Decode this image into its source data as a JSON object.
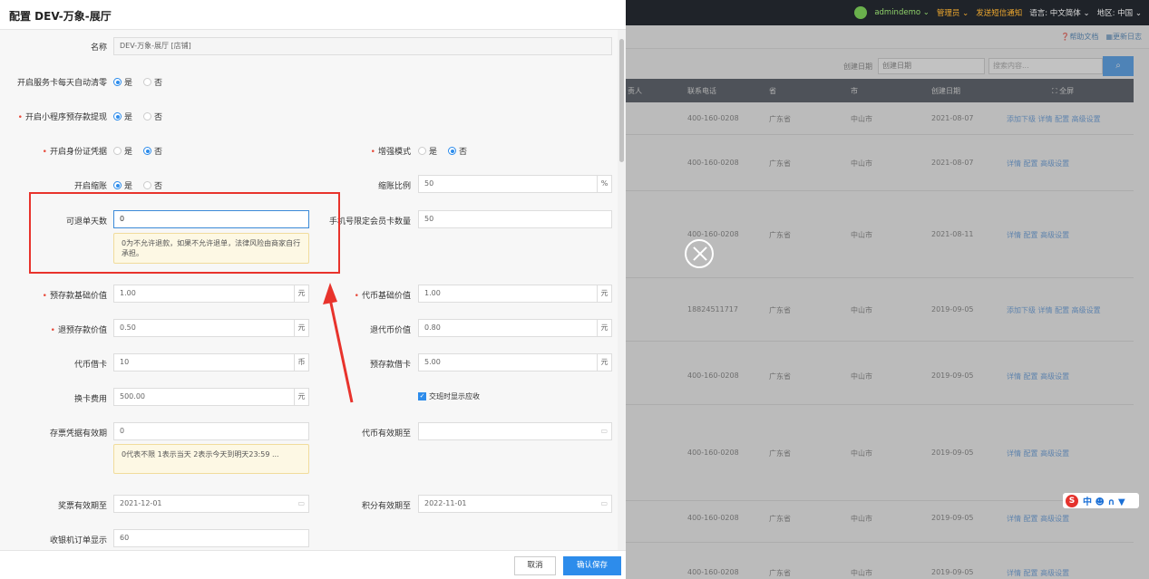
{
  "topbar": {
    "username": "admindemo ⌄",
    "role": "管理员 ⌄",
    "sms": "发送短信通知",
    "language": "语言: 中文简体 ⌄",
    "region": "地区: 中国 ⌄"
  },
  "subbar": {
    "help": "帮助文档",
    "changelog": "更新日志"
  },
  "filter": {
    "date_label": "创建日期",
    "date_placeholder": "创建日期",
    "search_placeholder": "搜索内容..."
  },
  "table": {
    "headers": [
      "责人",
      "联系电话",
      "省",
      "市",
      "创建日期",
      "⛶ 全屏"
    ],
    "rows": [
      {
        "phone": "400-160-0208",
        "province": "广东省",
        "city": "中山市",
        "date": "2021-08-07",
        "ops": "添加下级 详情 配置 高级设置"
      },
      {
        "phone": "400-160-0208",
        "province": "广东省",
        "city": "中山市",
        "date": "2021-08-07",
        "ops": "详情 配置 高级设置"
      },
      {
        "phone": "400-160-0208",
        "province": "广东省",
        "city": "中山市",
        "date": "2021-08-11",
        "ops": "详情 配置 高级设置"
      },
      {
        "phone": "18824511717",
        "province": "广东省",
        "city": "中山市",
        "date": "2019-09-05",
        "ops": "添加下级 详情 配置 高级设置"
      },
      {
        "phone": "400-160-0208",
        "province": "广东省",
        "city": "中山市",
        "date": "2019-09-05",
        "ops": "详情 配置 高级设置"
      },
      {
        "phone": "400-160-0208",
        "province": "广东省",
        "city": "中山市",
        "date": "2019-09-05",
        "ops": "详情 配置 高级设置"
      },
      {
        "phone": "400-160-0208",
        "province": "广东省",
        "city": "中山市",
        "date": "2019-09-05",
        "ops": "详情 配置 高级设置"
      },
      {
        "phone": "400-160-0208",
        "province": "广东省",
        "city": "中山市",
        "date": "2019-09-05",
        "ops": "详情 配置 高级设置"
      }
    ]
  },
  "ime": {
    "logo": "S",
    "items": "中 ☻ ∩ ▼"
  },
  "dialog": {
    "title": "配置 DEV-万象-展厅",
    "name_label": "名称",
    "name_value": "DEV-万象-展厅 [店铺]",
    "auto_clear_label": "开启服务卡每天自动清零",
    "mini_withdraw_label": "开启小程序预存款提现",
    "id_cert_label": "开启身份证凭据",
    "enhanced_label": "增强模式",
    "shrink_label": "开启缩账",
    "shrink_ratio_label": "缩账比例",
    "shrink_ratio_value": "50",
    "shrink_ratio_unit": "%",
    "refund_days_label": "可退单天数",
    "refund_days_value": "0",
    "refund_tip": "0为不允许退款，如果不允许退单，法律风险由商家自行承担。",
    "member_card_label": "手机号限定会员卡数量",
    "member_card_value": "50",
    "deposit_base_label": "预存款基础价值",
    "deposit_base_value": "1.00",
    "coin_base_label": "代币基础价值",
    "coin_base_value": "1.00",
    "refund_deposit_label": "退预存款价值",
    "refund_deposit_value": "0.50",
    "refund_coin_label": "退代币价值",
    "refund_coin_value": "0.80",
    "coin_loan_label": "代币借卡",
    "coin_loan_value": "10",
    "coin_unit": "币",
    "deposit_loan_label": "预存款借卡",
    "deposit_loan_value": "5.00",
    "change_fee_label": "换卡费用",
    "change_fee_value": "500.00",
    "shift_check": "交班时显示应收",
    "ticket_valid_label": "存票凭据有效期",
    "ticket_valid_value": "0",
    "ticket_tip": "0代表不限 1表示当天 2表示今天到明天23:59 ...",
    "coin_valid_label": "代币有效期至",
    "coin_valid_value": "",
    "prize_valid_label": "奖票有效期至",
    "prize_valid_value": "2021-12-01",
    "points_valid_label": "积分有效期至",
    "points_valid_value": "2022-11-01",
    "cashier_label": "收银机订单显示",
    "cashier_value": "60",
    "yuan": "元",
    "yes": "是",
    "no": "否",
    "cancel": "取消",
    "confirm": "确认保存"
  },
  "colors": {
    "accent": "#2d8ceb",
    "required": "#e84c3d",
    "annotation": "#e8332c"
  }
}
